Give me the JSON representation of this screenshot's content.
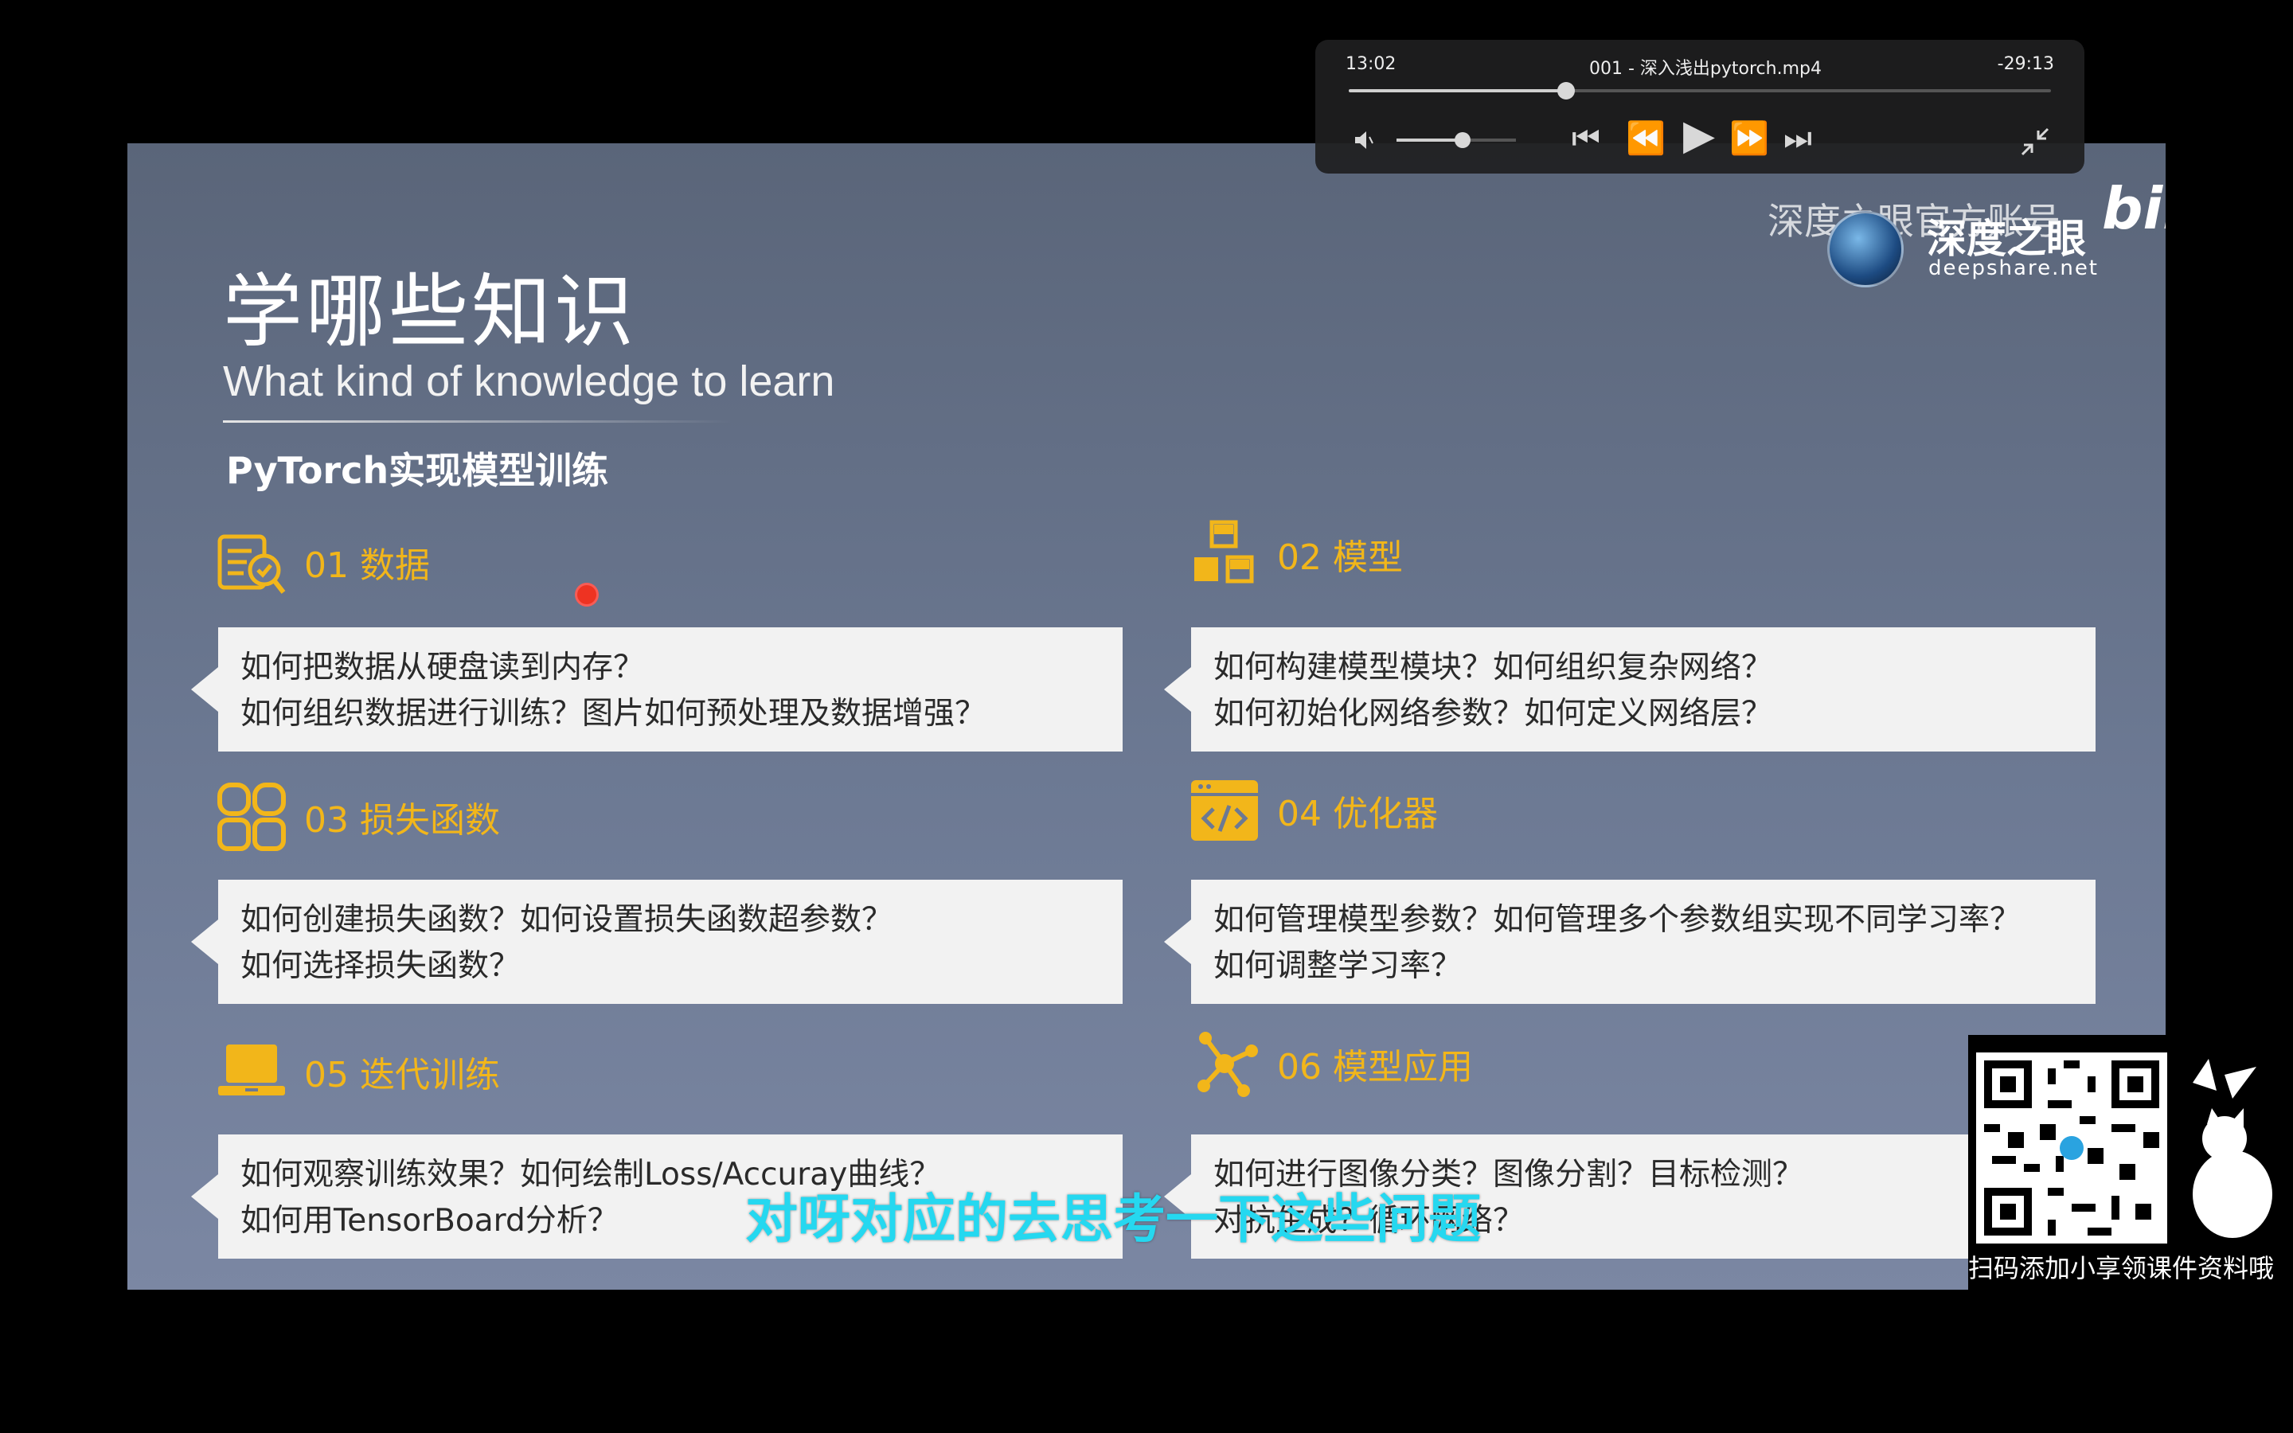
{
  "slide": {
    "title": "学哪些知识",
    "subtitle": "What kind of knowledge to learn",
    "section_title": "PyTorch实现模型训练",
    "sections": [
      {
        "label": "01 数据",
        "lines": [
          "如何把数据从硬盘读到内存？",
          "如何组织数据进行训练？图片如何预处理及数据增强？"
        ],
        "icon": "data-icon"
      },
      {
        "label": "02 模型",
        "lines": [
          "如何构建模型模块？如何组织复杂网络？",
          "如何初始化网络参数？如何定义网络层？"
        ],
        "icon": "cubes-icon"
      },
      {
        "label": "03 损失函数",
        "lines": [
          "如何创建损失函数？如何设置损失函数超参数？",
          "如何选择损失函数？"
        ],
        "icon": "grid-icon"
      },
      {
        "label": "04 优化器",
        "lines": [
          "如何管理模型参数？如何管理多个参数组实现不同学习率？",
          "如何调整学习率？"
        ],
        "icon": "code-icon"
      },
      {
        "label": "05 迭代训练",
        "lines": [
          "如何观察训练效果？如何绘制Loss/Accuray曲线？",
          "如何用TensorBoard分析？"
        ],
        "icon": "laptop-icon"
      },
      {
        "label": "06 模型应用",
        "lines": [
          "如何进行图像分类？图像分割？目标检测？",
          "对抗生成？循环网络？"
        ],
        "icon": "network-icon"
      }
    ],
    "watermark": {
      "text1": "深度之眼官方账号",
      "text2": "深度之眼",
      "url": "deepshare.net",
      "brand": "bilibili"
    }
  },
  "player": {
    "elapsed": "13:02",
    "filename": "001 - 深入浅出pytorch.mp4",
    "remaining": "-29:13",
    "progress": 0.31,
    "volume": 0.55
  },
  "qr": {
    "caption": "扫码添加小享领课件资料哦"
  },
  "caption": "对呀对应的去思考一下这些问题",
  "colors": {
    "accent": "#f2b61a",
    "caption": "#25d8f0"
  }
}
